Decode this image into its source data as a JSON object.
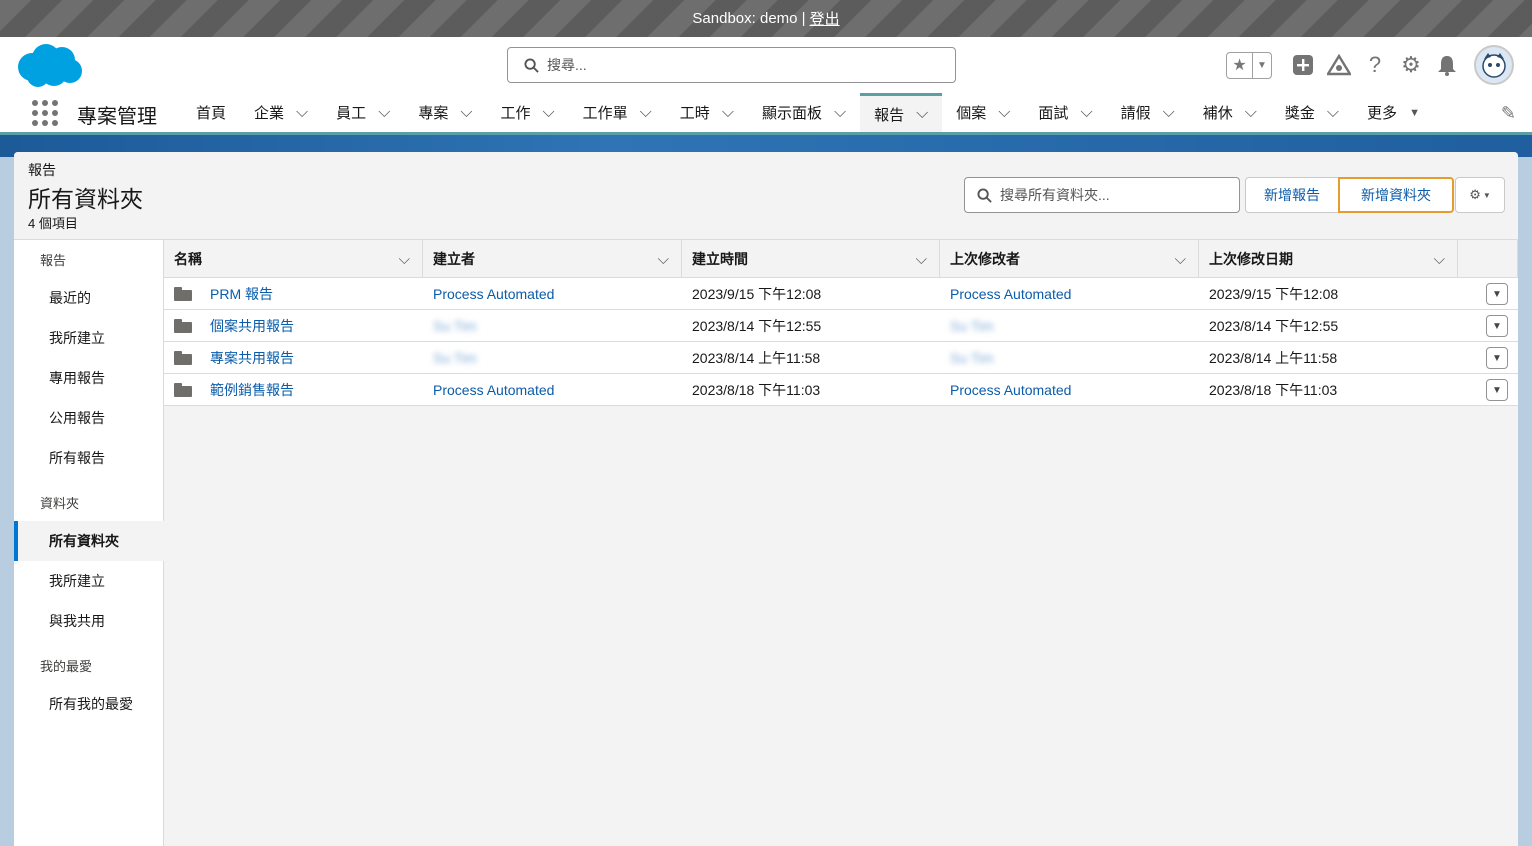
{
  "sandbox": {
    "text": "Sandbox: demo |",
    "logout": "登出"
  },
  "header": {
    "search_placeholder": "搜尋...",
    "icons": [
      "favorites-star-icon",
      "add-icon",
      "trailhead-icon",
      "help-icon",
      "setup-gear-icon",
      "notifications-bell-icon",
      "user-avatar"
    ]
  },
  "nav": {
    "app_name": "專案管理",
    "items": [
      {
        "label": "首頁",
        "has_menu": false
      },
      {
        "label": "企業",
        "has_menu": true
      },
      {
        "label": "員工",
        "has_menu": true
      },
      {
        "label": "專案",
        "has_menu": true
      },
      {
        "label": "工作",
        "has_menu": true
      },
      {
        "label": "工作單",
        "has_menu": true
      },
      {
        "label": "工時",
        "has_menu": true
      },
      {
        "label": "顯示面板",
        "has_menu": true
      },
      {
        "label": "報告",
        "has_menu": true,
        "active": true
      },
      {
        "label": "個案",
        "has_menu": true
      },
      {
        "label": "面試",
        "has_menu": true
      },
      {
        "label": "請假",
        "has_menu": true
      },
      {
        "label": "補休",
        "has_menu": true
      },
      {
        "label": "獎金",
        "has_menu": true
      },
      {
        "label": "更多",
        "has_menu": true
      }
    ]
  },
  "page": {
    "eyebrow": "報告",
    "title": "所有資料夾",
    "count": "4 個項目",
    "search_placeholder": "搜尋所有資料夾...",
    "new_report": "新增報告",
    "new_folder": "新增資料夾"
  },
  "sidebar": {
    "sections": [
      {
        "title": "報告",
        "items": [
          "最近的",
          "我所建立",
          "專用報告",
          "公用報告",
          "所有報告"
        ]
      },
      {
        "title": "資料夾",
        "items": [
          "所有資料夾",
          "我所建立",
          "與我共用"
        ],
        "selected": 0
      },
      {
        "title": "我的最愛",
        "items": [
          "所有我的最愛"
        ]
      }
    ]
  },
  "table": {
    "columns": [
      "名稱",
      "建立者",
      "建立時間",
      "上次修改者",
      "上次修改日期"
    ],
    "rows": [
      {
        "name": "PRM 報告",
        "created_by": "Process Automated",
        "created_at": "2023/9/15 下午12:08",
        "modified_by": "Process Automated",
        "modified_at": "2023/9/15 下午12:08",
        "blurred": false
      },
      {
        "name": "個案共用報告",
        "created_by": "Su Tim",
        "created_at": "2023/8/14 下午12:55",
        "modified_by": "Su Tim",
        "modified_at": "2023/8/14 下午12:55",
        "blurred": true
      },
      {
        "name": "專案共用報告",
        "created_by": "Su Tim",
        "created_at": "2023/8/14 上午11:58",
        "modified_by": "Su Tim",
        "modified_at": "2023/8/14 上午11:58",
        "blurred": true
      },
      {
        "name": "範例銷售報告",
        "created_by": "Process Automated",
        "created_at": "2023/8/18 下午11:03",
        "modified_by": "Process Automated",
        "modified_at": "2023/8/18 下午11:03",
        "blurred": false
      }
    ]
  },
  "colors": {
    "brand": "#0b5cab",
    "nav_accent": "#5b9ea6",
    "highlight": "#e59b2d",
    "salesforce_blue": "#00a1e0"
  }
}
